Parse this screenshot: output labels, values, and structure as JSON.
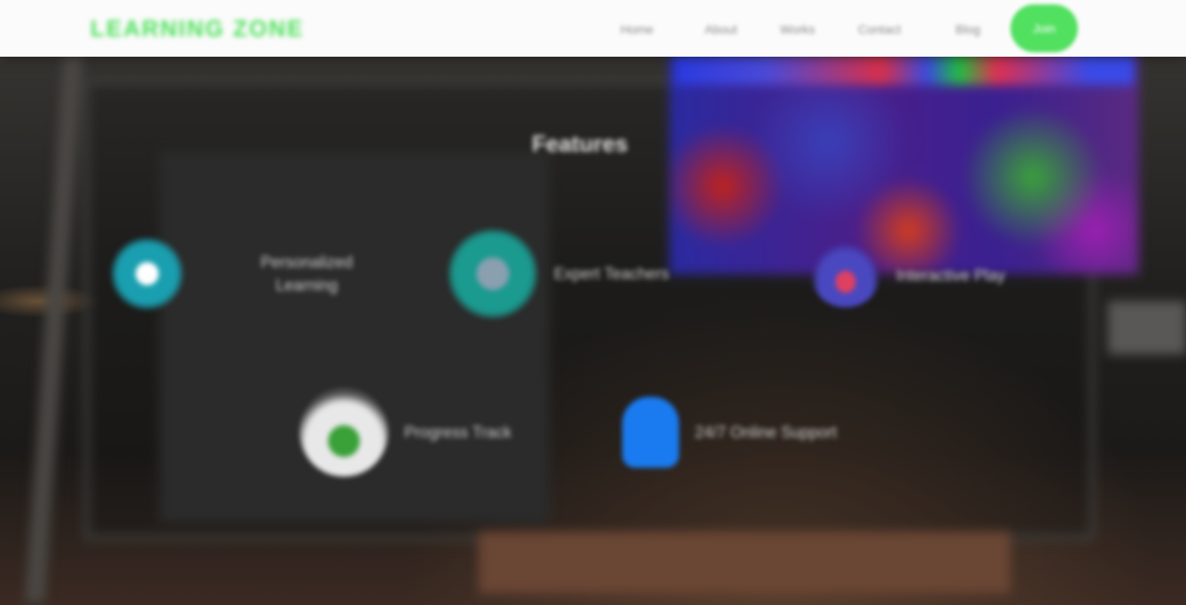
{
  "header": {
    "logo_text": "Learning Zone",
    "nav": [
      "Home",
      "About",
      "Works",
      "Contact",
      "Blog"
    ],
    "cta_label": "Join"
  },
  "main": {
    "section_title": "Features",
    "features": [
      {
        "label": "Personalized Learning",
        "icon": "chat-bubble-icon"
      },
      {
        "label": "Expert Teachers",
        "icon": "teacher-avatar-icon"
      },
      {
        "label": "Interactive Play",
        "icon": "rainbow-icon"
      },
      {
        "label": "Progress Track",
        "icon": "growth-chart-icon"
      },
      {
        "label": "24/7 Online Support",
        "icon": "user-icon"
      }
    ]
  },
  "colors": {
    "brand_green": "#4be058",
    "cta_green": "#52e060",
    "support_blue": "#1a7bf0",
    "teal": "#1a9fb0"
  }
}
